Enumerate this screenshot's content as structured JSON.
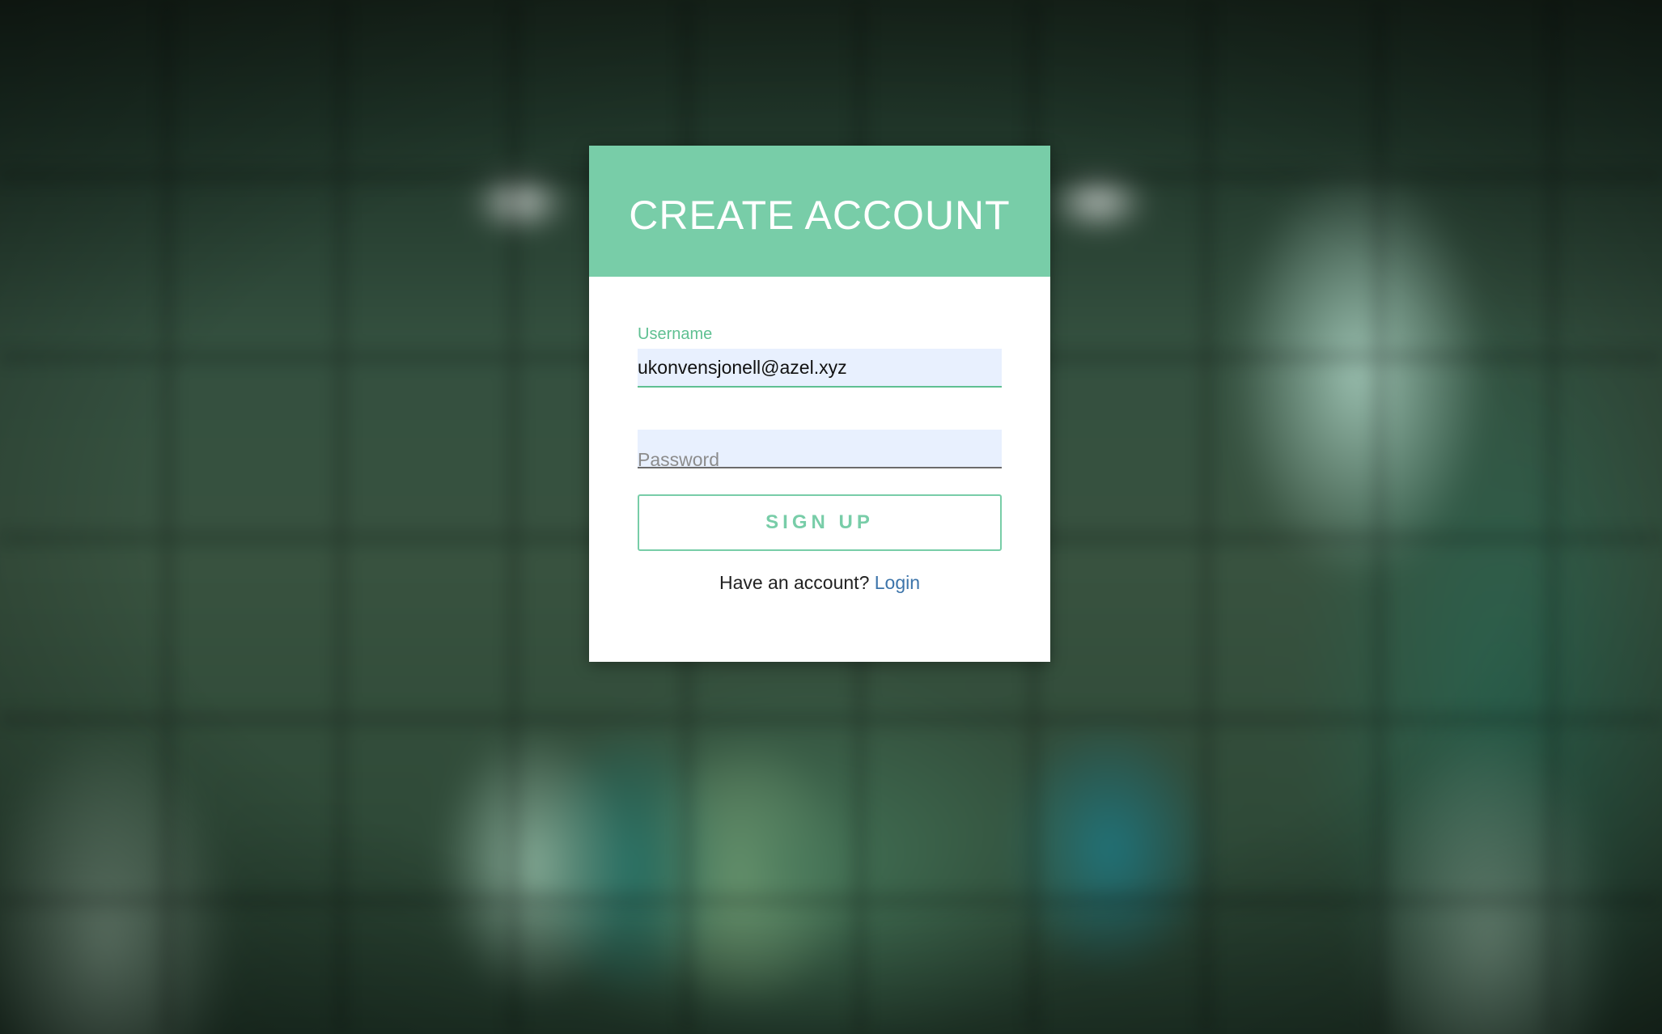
{
  "form": {
    "title": "CREATE ACCOUNT",
    "username_label": "Username",
    "username_value": "ukonvensjonell@azel.xyz",
    "password_placeholder": "Password",
    "signup_label": "SIGN UP",
    "footer_text": "Have an account?",
    "login_link": "Login"
  },
  "colors": {
    "accent": "#78cda8",
    "label_green": "#5fc092",
    "link_blue": "#3c74aa",
    "autofill_bg": "#e8f0fe"
  }
}
